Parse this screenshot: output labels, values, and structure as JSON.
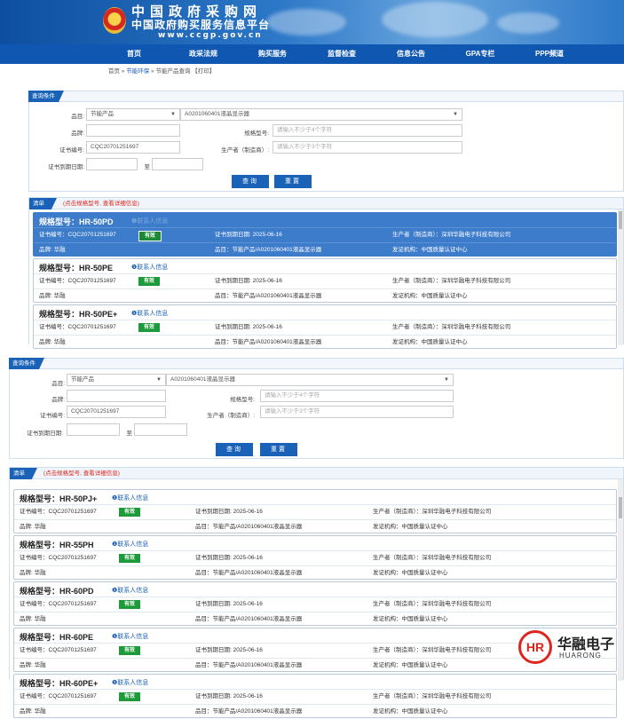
{
  "header": {
    "title": "中国政府采购网",
    "subtitle": "中国政府购买服务信息平台",
    "url": "www.ccgp.gov.cn",
    "brand_color": "#0f57b0"
  },
  "nav": [
    "首页",
    "政采法规",
    "购买服务",
    "监督检查",
    "信息公告",
    "GPA专栏",
    "PPP频道"
  ],
  "breadcrumb": {
    "home": "首页",
    "sep1": " » ",
    "section": "节能环保",
    "sep2": " » 节能产品查询 ",
    "print": "【打印】"
  },
  "query": {
    "tab": "查询条件",
    "category_label": "品目:",
    "category_value": "节能产品",
    "subcategory_value": "A0201060401液晶显示器",
    "brand_label": "品牌:",
    "brand_value": "",
    "model_label": "规格型号:",
    "model_placeholder": "请输入不少于4个字符",
    "cert_label": "证书编号:",
    "cert_value": "CQC20701251697",
    "maker_label": "生产者（制造商）:",
    "maker_placeholder": "请输入不少于3个字符",
    "expiry_label": "证书到期日期:",
    "expiry_to": "至",
    "search_button": "查询",
    "reset_button": "重置"
  },
  "list": {
    "tab": "清单",
    "hint": "(点击规格型号, 查看详细信息)",
    "contact": "❶联系人信息",
    "cert_prefix": "证书编号：CQC20701251697",
    "status": "有效",
    "expiry": "证书到期日期: 2025-06-16",
    "maker": "生产者（制造商）：深圳华融电子科技有限公司",
    "brand": "品牌: 华融",
    "category": "品目：节能产品/A0201060401液晶显示器",
    "issuer": "发证机构：中国质量认证中心"
  },
  "cards_top": [
    {
      "model": "规格型号：HR-50PD",
      "selected": true
    },
    {
      "model": "规格型号：HR-50PE",
      "selected": false
    },
    {
      "model": "规格型号：HR-50PE+",
      "selected": false
    }
  ],
  "cards_bottom": [
    {
      "model": "规格型号：HR-50PJ+"
    },
    {
      "model": "规格型号：HR-55PH"
    },
    {
      "model": "规格型号：HR-60PD"
    },
    {
      "model": "规格型号：HR-60PE"
    },
    {
      "model": "规格型号：HR-60PE+"
    }
  ],
  "watermark": {
    "logo_cn": "华融电子",
    "logo_en": "HUARONG",
    "mark": "HR",
    "accent": "#e0231c"
  }
}
